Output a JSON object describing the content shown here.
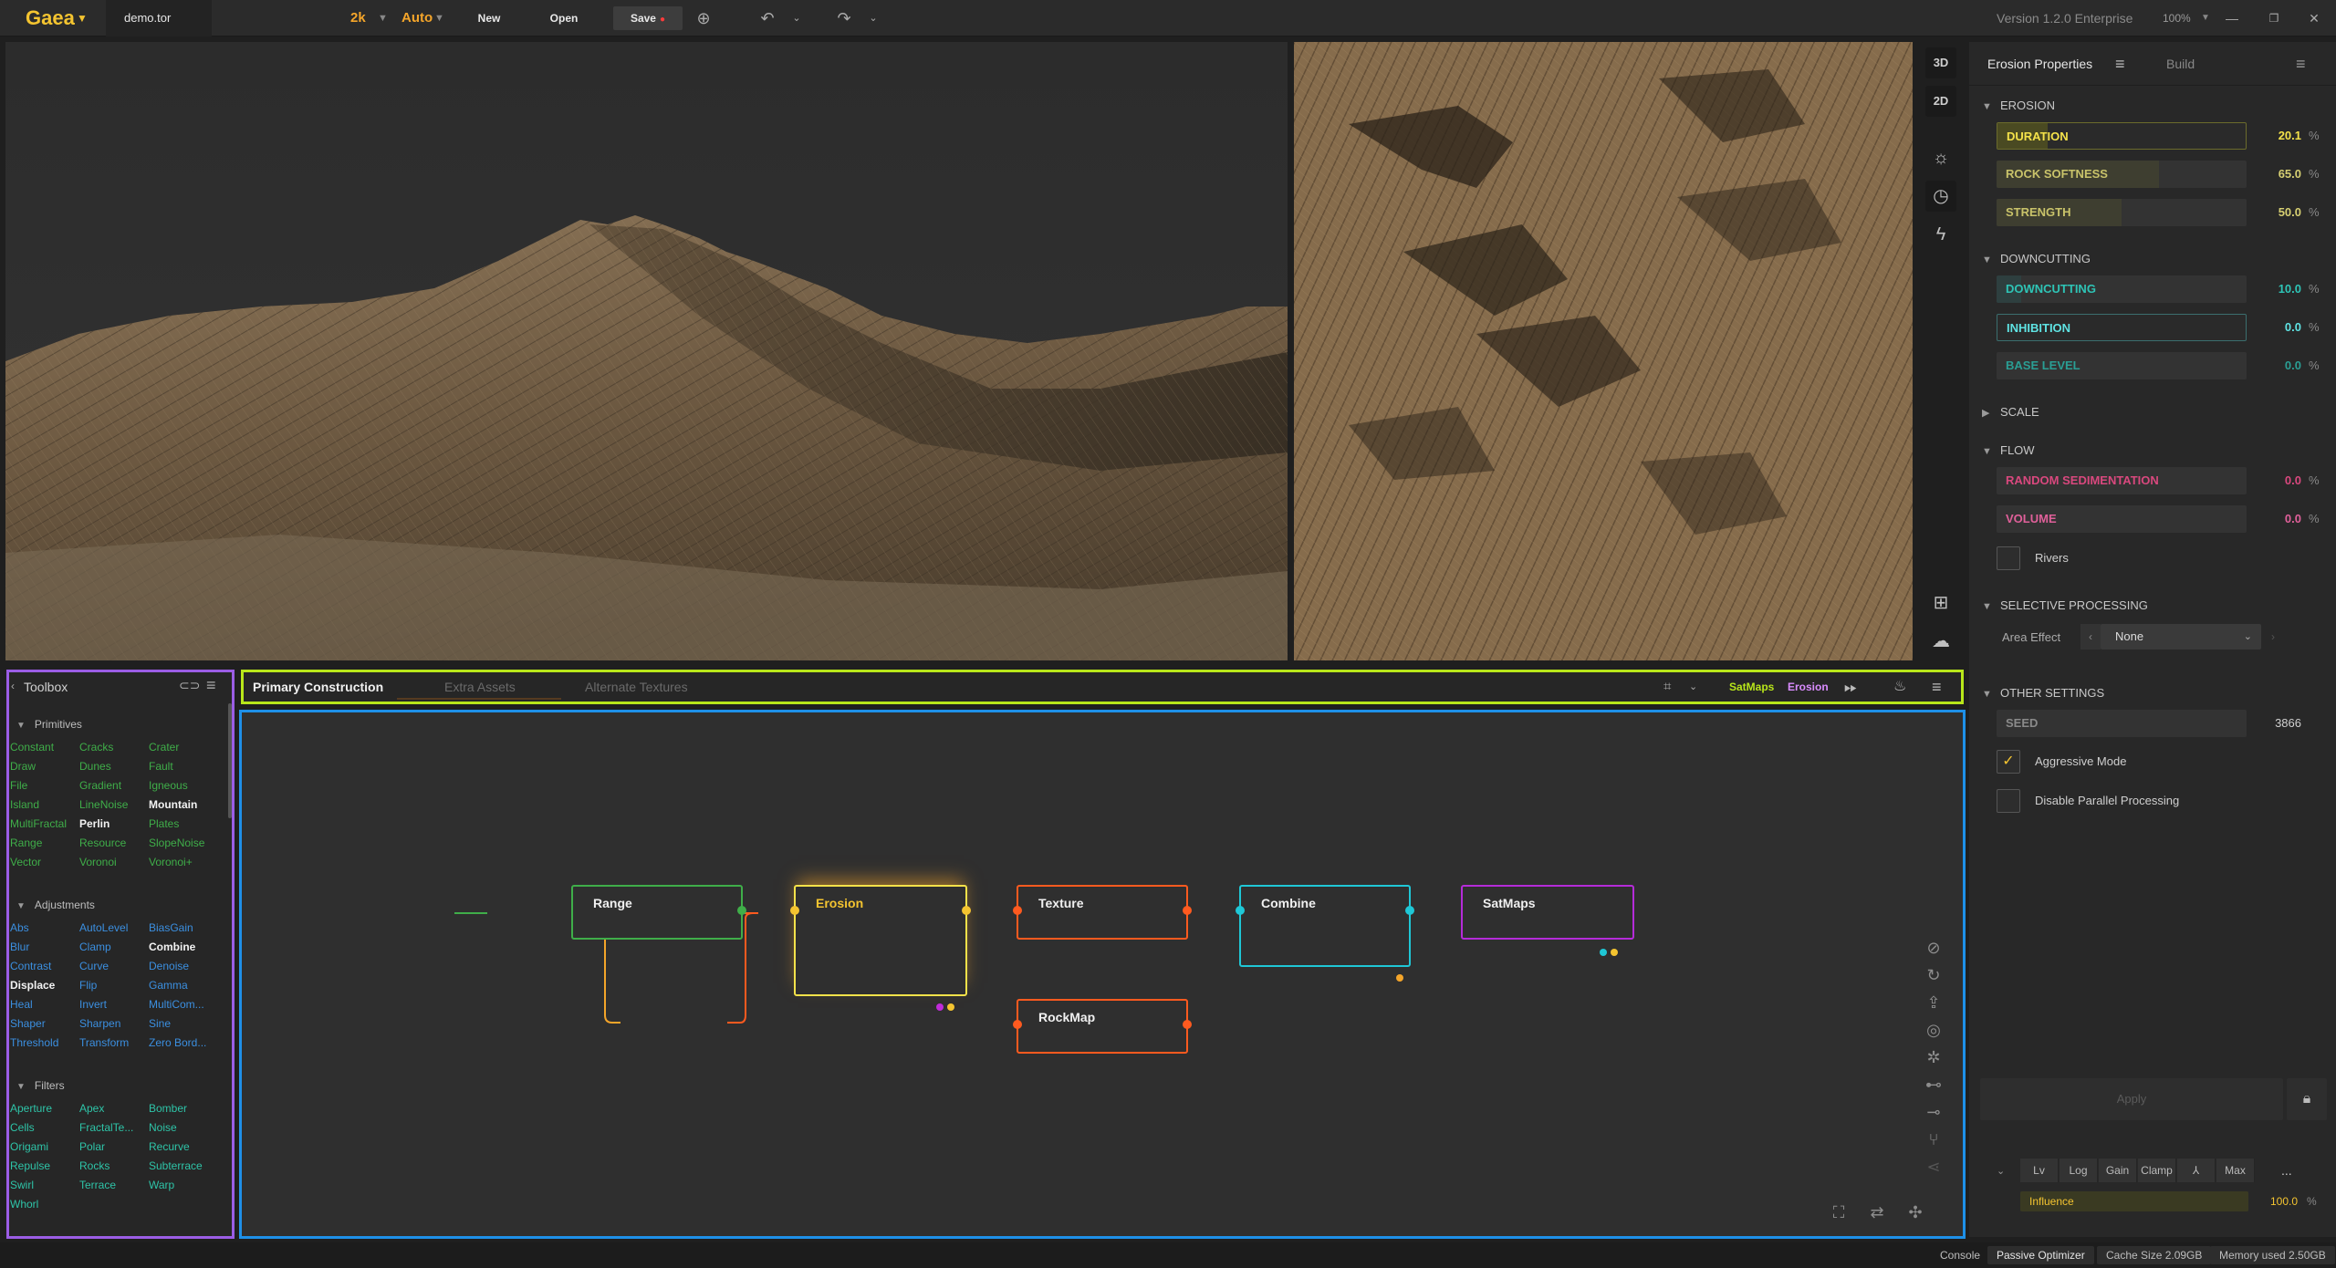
{
  "topbar": {
    "brand": "Gaea",
    "file": "demo.tor",
    "resolution": "2k",
    "mode": "Auto",
    "new_label": "New",
    "open_label": "Open",
    "save_label": "Save",
    "version": "Version 1.2.0 Enterprise",
    "zoom": "100%"
  },
  "viewport_tools": [
    "3D",
    "2D"
  ],
  "right_panel": {
    "tab_active": "Erosion Properties",
    "tab_other": "Build",
    "sections": {
      "erosion": "EROSION",
      "downcutting": "DOWNCUTTING",
      "scale": "SCALE",
      "flow": "FLOW",
      "selective": "SELECTIVE PROCESSING",
      "other": "OTHER SETTINGS"
    },
    "params": {
      "duration": {
        "label": "DURATION",
        "value": "20.1",
        "unit": "%",
        "level": 0.201
      },
      "rock_softness": {
        "label": "ROCK SOFTNESS",
        "value": "65.0",
        "unit": "%",
        "level": 0.65
      },
      "strength": {
        "label": "STRENGTH",
        "value": "50.0",
        "unit": "%",
        "level": 0.5
      },
      "downcutting": {
        "label": "DOWNCUTTING",
        "value": "10.0",
        "unit": "%",
        "level": 0.1
      },
      "inhibition": {
        "label": "INHIBITION",
        "value": "0.0",
        "unit": "%",
        "level": 0.0
      },
      "base_level": {
        "label": "BASE LEVEL",
        "value": "0.0",
        "unit": "%",
        "level": 0.0
      },
      "random_sed": {
        "label": "RANDOM SEDIMENTATION",
        "value": "0.0",
        "unit": "%",
        "level": 0.0
      },
      "volume": {
        "label": "VOLUME",
        "value": "0.0",
        "unit": "%",
        "level": 0.0
      },
      "seed": {
        "label": "SEED",
        "value": "3866"
      },
      "influence": {
        "label": "Influence",
        "value": "100.0",
        "unit": "%",
        "level": 1.0
      }
    },
    "rivers_label": "Rivers",
    "area_effect_label": "Area Effect",
    "area_effect_value": "None",
    "aggressive_label": "Aggressive Mode",
    "aggressive_checked": "✓",
    "disable_parallel_label": "Disable Parallel Processing",
    "apply_label": "Apply",
    "modifiers": [
      "Lv",
      "Log",
      "Gain",
      "Clamp",
      "⅄",
      "Max"
    ],
    "more_label": "..."
  },
  "toolbox": {
    "title": "Toolbox",
    "primitives_title": "Primitives",
    "primitives": [
      [
        "Constant",
        "Cracks",
        "Crater"
      ],
      [
        "Draw",
        "Dunes",
        "Fault"
      ],
      [
        "File",
        "Gradient",
        "Igneous"
      ],
      [
        "Island",
        "LineNoise",
        "Mountain"
      ],
      [
        "MultiFractal",
        "Perlin",
        "Plates"
      ],
      [
        "Range",
        "Resource",
        "SlopeNoise"
      ],
      [
        "Vector",
        "Voronoi",
        "Voronoi+"
      ]
    ],
    "adjustments_title": "Adjustments",
    "adjustments": [
      [
        "Abs",
        "AutoLevel",
        "BiasGain"
      ],
      [
        "Blur",
        "Clamp",
        "Combine"
      ],
      [
        "Contrast",
        "Curve",
        "Denoise"
      ],
      [
        "Displace",
        "Flip",
        "Gamma"
      ],
      [
        "Heal",
        "Invert",
        "MultiCom..."
      ],
      [
        "Shaper",
        "Sharpen",
        "Sine"
      ],
      [
        "Threshold",
        "Transform",
        "Zero Bord..."
      ]
    ],
    "filters_title": "Filters",
    "filters": [
      [
        "Aperture",
        "Apex",
        "Bomber"
      ],
      [
        "Cells",
        "FractalTe...",
        "Noise"
      ],
      [
        "Origami",
        "Polar",
        "Recurve"
      ],
      [
        "Repulse",
        "Rocks",
        "Subterrace"
      ],
      [
        "Swirl",
        "Terrace",
        "Warp"
      ],
      [
        "Whorl",
        "",
        ""
      ]
    ]
  },
  "graph": {
    "tabs": [
      "Primary Construction",
      "Extra Assets",
      "Alternate Textures"
    ],
    "crumb_satmaps": "SatMaps",
    "crumb_erosion": "Erosion",
    "nodes": {
      "range": "Range",
      "erosion": "Erosion",
      "texture": "Texture",
      "rockmap": "RockMap",
      "combine": "Combine",
      "satmaps": "SatMaps"
    }
  },
  "status": {
    "console": "Console",
    "optimizer": "Passive Optimizer",
    "cache": "Cache Size 2.09GB",
    "memory": "Memory used 2.50GB"
  },
  "colors": {
    "accent_yellow": "#f4c430",
    "toolbox_border": "#9b5de5",
    "graph_header_border": "#b8e61a",
    "graph_border": "#1e90e8"
  }
}
